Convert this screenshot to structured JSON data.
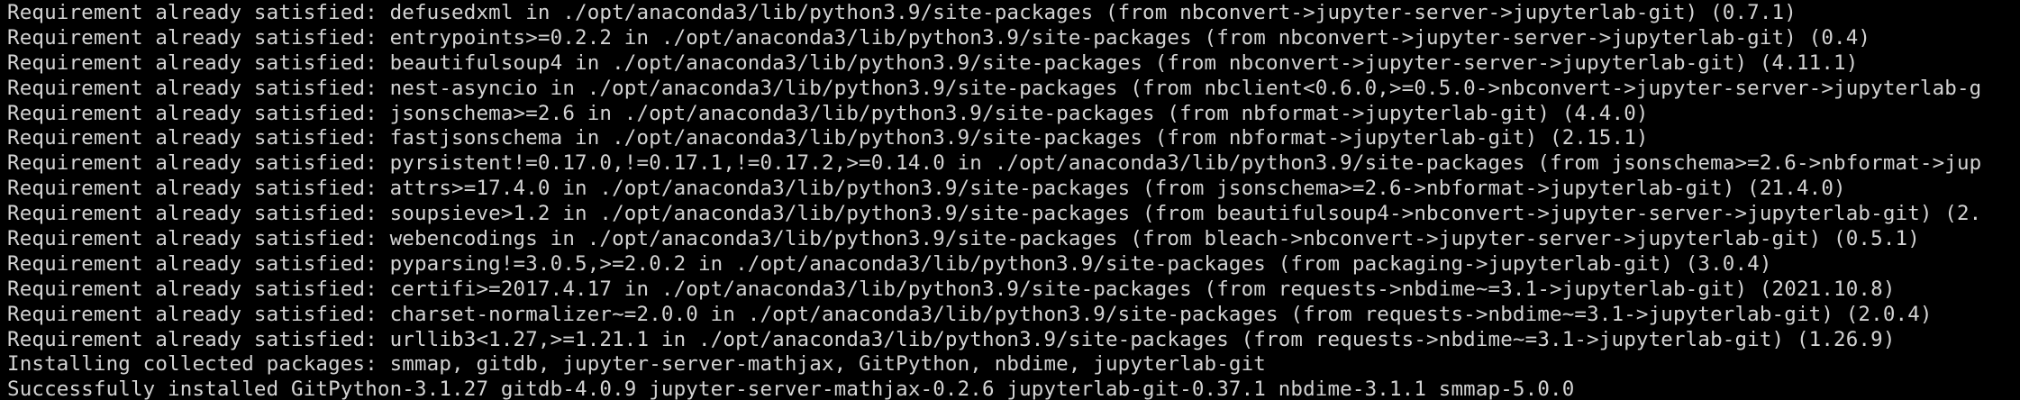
{
  "terminal": {
    "lines": [
      "Requirement already satisfied: defusedxml in ./opt/anaconda3/lib/python3.9/site-packages (from nbconvert->jupyter-server->jupyterlab-git) (0.7.1)",
      "Requirement already satisfied: entrypoints>=0.2.2 in ./opt/anaconda3/lib/python3.9/site-packages (from nbconvert->jupyter-server->jupyterlab-git) (0.4)",
      "Requirement already satisfied: beautifulsoup4 in ./opt/anaconda3/lib/python3.9/site-packages (from nbconvert->jupyter-server->jupyterlab-git) (4.11.1)",
      "Requirement already satisfied: nest-asyncio in ./opt/anaconda3/lib/python3.9/site-packages (from nbclient<0.6.0,>=0.5.0->nbconvert->jupyter-server->jupyterlab-g",
      "Requirement already satisfied: jsonschema>=2.6 in ./opt/anaconda3/lib/python3.9/site-packages (from nbformat->jupyterlab-git) (4.4.0)",
      "Requirement already satisfied: fastjsonschema in ./opt/anaconda3/lib/python3.9/site-packages (from nbformat->jupyterlab-git) (2.15.1)",
      "Requirement already satisfied: pyrsistent!=0.17.0,!=0.17.1,!=0.17.2,>=0.14.0 in ./opt/anaconda3/lib/python3.9/site-packages (from jsonschema>=2.6->nbformat->jup",
      "Requirement already satisfied: attrs>=17.4.0 in ./opt/anaconda3/lib/python3.9/site-packages (from jsonschema>=2.6->nbformat->jupyterlab-git) (21.4.0)",
      "Requirement already satisfied: soupsieve>1.2 in ./opt/anaconda3/lib/python3.9/site-packages (from beautifulsoup4->nbconvert->jupyter-server->jupyterlab-git) (2.",
      "Requirement already satisfied: webencodings in ./opt/anaconda3/lib/python3.9/site-packages (from bleach->nbconvert->jupyter-server->jupyterlab-git) (0.5.1)",
      "Requirement already satisfied: pyparsing!=3.0.5,>=2.0.2 in ./opt/anaconda3/lib/python3.9/site-packages (from packaging->jupyterlab-git) (3.0.4)",
      "Requirement already satisfied: certifi>=2017.4.17 in ./opt/anaconda3/lib/python3.9/site-packages (from requests->nbdime~=3.1->jupyterlab-git) (2021.10.8)",
      "Requirement already satisfied: charset-normalizer~=2.0.0 in ./opt/anaconda3/lib/python3.9/site-packages (from requests->nbdime~=3.1->jupyterlab-git) (2.0.4)",
      "Requirement already satisfied: urllib3<1.27,>=1.21.1 in ./opt/anaconda3/lib/python3.9/site-packages (from requests->nbdime~=3.1->jupyterlab-git) (1.26.9)",
      "Installing collected packages: smmap, gitdb, jupyter-server-mathjax, GitPython, nbdime, jupyterlab-git",
      "Successfully installed GitPython-3.1.27 gitdb-4.0.9 jupyter-server-mathjax-0.2.6 jupyterlab-git-0.37.1 nbdime-3.1.1 smmap-5.0.0"
    ],
    "text_color": "#d3d3d3",
    "background_color": "#000000"
  }
}
